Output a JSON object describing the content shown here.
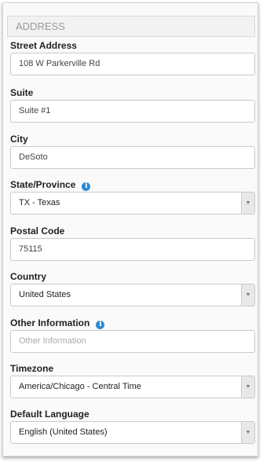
{
  "section": {
    "title": "ADDRESS"
  },
  "fields": {
    "street": {
      "label": "Street Address",
      "value": "108 W Parkerville Rd"
    },
    "suite": {
      "label": "Suite",
      "value": "Suite #1"
    },
    "city": {
      "label": "City",
      "value": "DeSoto"
    },
    "state": {
      "label": "State/Province",
      "value": "TX - Texas"
    },
    "postal": {
      "label": "Postal Code",
      "value": "75115"
    },
    "country": {
      "label": "Country",
      "value": "United States"
    },
    "other": {
      "label": "Other Information",
      "value": "",
      "placeholder": "Other Information"
    },
    "timezone": {
      "label": "Timezone",
      "value": "America/Chicago - Central Time"
    },
    "language": {
      "label": "Default Language",
      "value": "English (United States)"
    }
  },
  "icons": {
    "info": "info-icon",
    "caret": "chevron-down-icon"
  },
  "colors": {
    "info_icon": "#2f88d2"
  }
}
